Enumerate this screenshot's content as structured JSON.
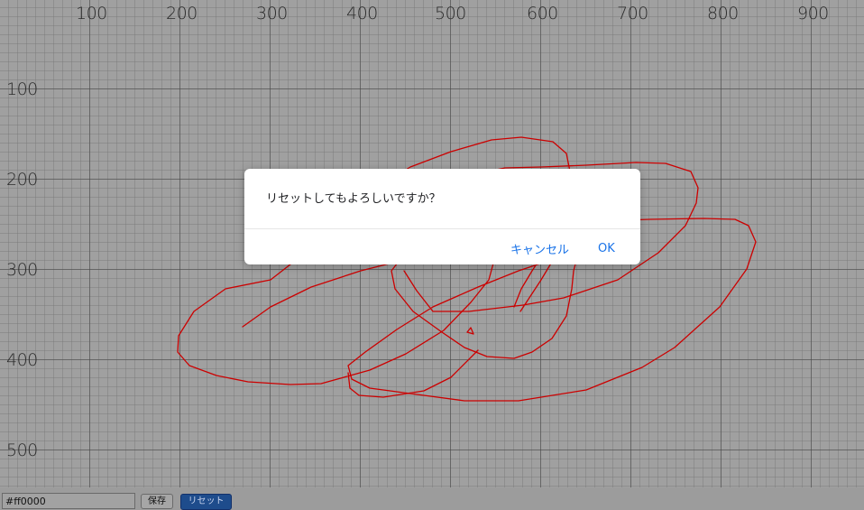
{
  "canvas": {
    "x_labels": [
      "100",
      "200",
      "300",
      "400",
      "500",
      "600",
      "700",
      "800",
      "900"
    ],
    "y_labels": [
      "100",
      "200",
      "300",
      "400",
      "500"
    ],
    "stroke_color": "#cc0000"
  },
  "toolbar": {
    "color_value": "#ff0000",
    "save_label": "保存",
    "reset_label": "リセット"
  },
  "dialog": {
    "message": "リセットしてもよろしいですか？",
    "cancel_label": "キャンセル",
    "ok_label": "OK"
  }
}
